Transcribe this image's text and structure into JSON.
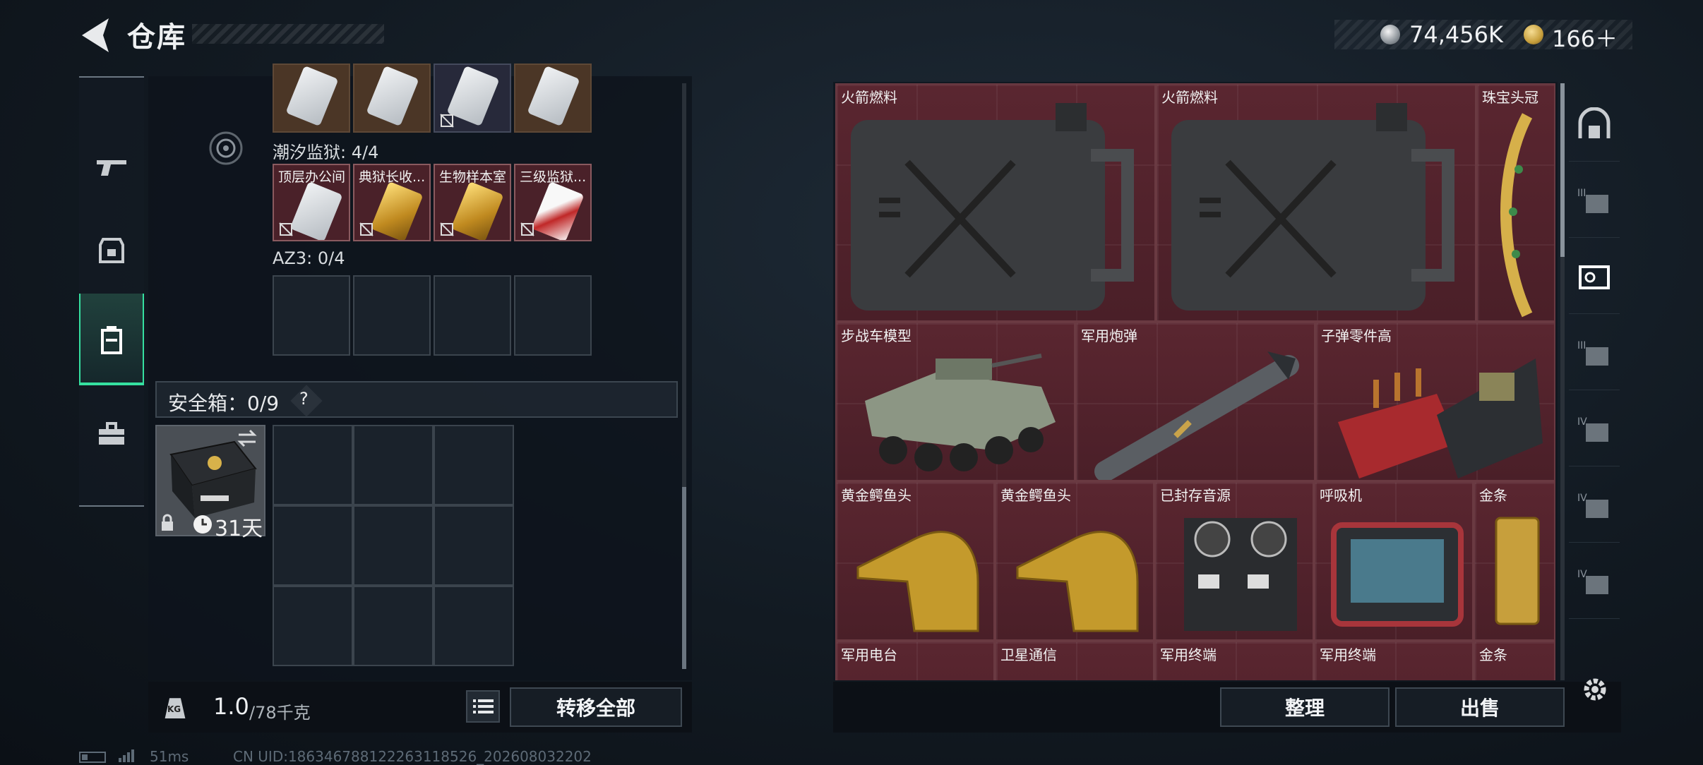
{
  "header": {
    "title": "仓库"
  },
  "currency": {
    "silver": "74,456K",
    "gold": "166＋"
  },
  "left_rail": [
    "gun-icon",
    "armor-icon",
    "keycard-box-icon",
    "briefcase-icon"
  ],
  "left_panel": {
    "top_row_cards": [
      "",
      "",
      "",
      ""
    ],
    "chaoxi": {
      "label": "潮汐监狱: 4/4",
      "cards": [
        "顶层办公间",
        "典狱长收...",
        "生物样本室",
        "三级监狱..."
      ]
    },
    "az3": {
      "label": "AZ3: 0/4"
    },
    "safe": {
      "label": "安全箱：0/9",
      "help": "?",
      "days": "31天"
    }
  },
  "weight": {
    "value": "1.0",
    "cap": "/78千克",
    "kg": "KG"
  },
  "buttons": {
    "transfer_all": "转移全部",
    "organize": "整理",
    "sell": "出售"
  },
  "right_items": [
    {
      "name": "火箭燃料"
    },
    {
      "name": "火箭燃料"
    },
    {
      "name": "珠宝头冠"
    },
    {
      "name": "步战车模型"
    },
    {
      "name": "军用炮弹"
    },
    {
      "name": "子弹零件高"
    },
    {
      "name": "黄金鳄鱼头"
    },
    {
      "name": "黄金鳄鱼头"
    },
    {
      "name": "已封存音源"
    },
    {
      "name": "呼吸机"
    },
    {
      "name": "金条"
    },
    {
      "name": "军用电台"
    },
    {
      "name": "卫星通信"
    },
    {
      "name": "军用终端"
    },
    {
      "name": "军用终端"
    },
    {
      "name": "金条"
    }
  ],
  "status": {
    "ping": "51ms",
    "uid": "CN UID:186346788122263118526_202608032202"
  }
}
